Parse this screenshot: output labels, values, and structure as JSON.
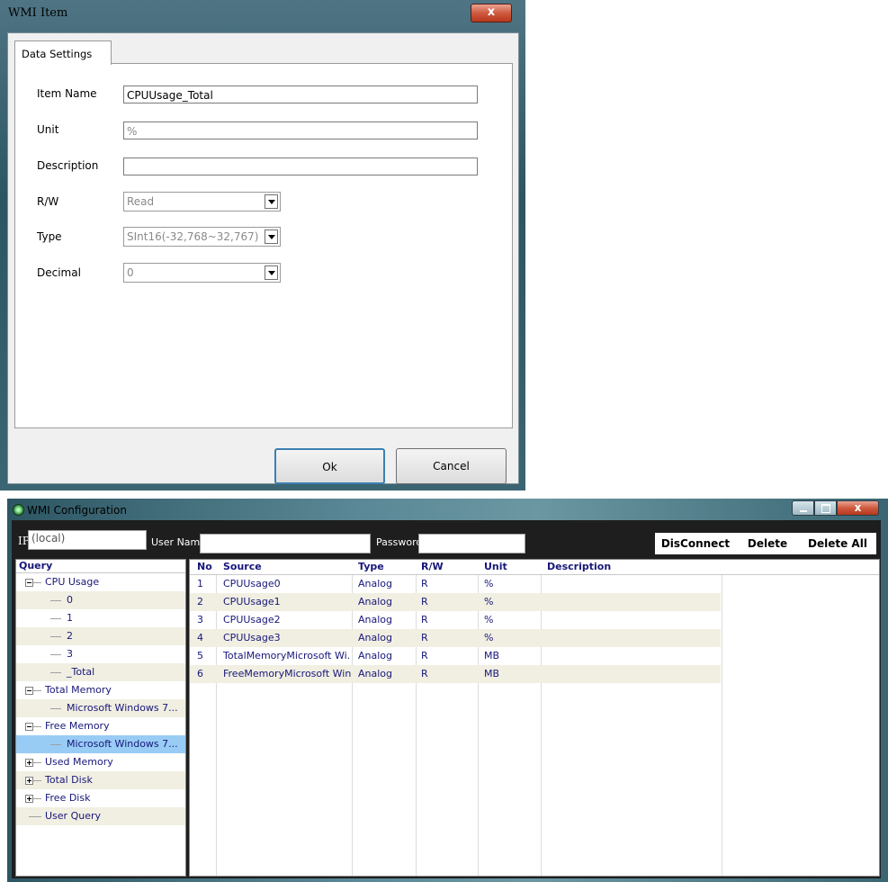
{
  "item_dialog": {
    "title": "WMI Item",
    "close_glyph": "x",
    "tab_label": "Data Settings",
    "fields": {
      "item_name": {
        "label": "Item Name",
        "value": "CPUUsage_Total"
      },
      "unit": {
        "label": "Unit",
        "value": "%"
      },
      "description": {
        "label": "Description",
        "value": ""
      },
      "rw": {
        "label": "R/W",
        "value": "Read"
      },
      "type": {
        "label": "Type",
        "value": "SInt16(-32,768~32,767)"
      },
      "decimal": {
        "label": "Decimal",
        "value": "0"
      }
    },
    "ok_label": "Ok",
    "cancel_label": "Cancel"
  },
  "config_window": {
    "title": "WMI Configuration",
    "close_glyph": "x",
    "ip_label": "IP",
    "ip_value": "(local)",
    "username_label": "User Name",
    "username_value": "",
    "password_label": "Password",
    "password_value": "",
    "buttons": {
      "disconnect": "DisConnect",
      "delete": "Delete",
      "delete_all": "Delete All"
    },
    "tree": {
      "header": "Query",
      "nodes": [
        {
          "label": "CPU Usage",
          "level": 0,
          "expander": "minus"
        },
        {
          "label": "0",
          "level": 1
        },
        {
          "label": "1",
          "level": 1
        },
        {
          "label": "2",
          "level": 1
        },
        {
          "label": "3",
          "level": 1
        },
        {
          "label": "_Total",
          "level": 1
        },
        {
          "label": "Total Memory",
          "level": 0,
          "expander": "minus"
        },
        {
          "label": "Microsoft Windows 7...",
          "level": 1
        },
        {
          "label": "Free Memory",
          "level": 0,
          "expander": "minus"
        },
        {
          "label": "Microsoft Windows 7...",
          "level": 1,
          "selected": true
        },
        {
          "label": "Used Memory",
          "level": 0,
          "expander": "plus"
        },
        {
          "label": "Total Disk",
          "level": 0,
          "expander": "plus"
        },
        {
          "label": "Free Disk",
          "level": 0,
          "expander": "plus"
        },
        {
          "label": "User Query",
          "level": 0
        }
      ]
    },
    "grid": {
      "columns": [
        "No",
        "Source",
        "Type",
        "R/W",
        "Unit",
        "Description"
      ],
      "rows": [
        [
          "1",
          "CPUUsage0",
          "Analog",
          "R",
          "%",
          ""
        ],
        [
          "2",
          "CPUUsage1",
          "Analog",
          "R",
          "%",
          ""
        ],
        [
          "3",
          "CPUUsage2",
          "Analog",
          "R",
          "%",
          ""
        ],
        [
          "4",
          "CPUUsage3",
          "Analog",
          "R",
          "%",
          ""
        ],
        [
          "5",
          "TotalMemoryMicrosoft Wi...",
          "Analog",
          "R",
          "MB",
          ""
        ],
        [
          "6",
          "FreeMemoryMicrosoft Win...",
          "Analog",
          "R",
          "MB",
          ""
        ]
      ]
    }
  },
  "colors": {
    "selection": "#99ccf5",
    "alt_row": "#f1efe2",
    "text_navy": "#17177a"
  }
}
